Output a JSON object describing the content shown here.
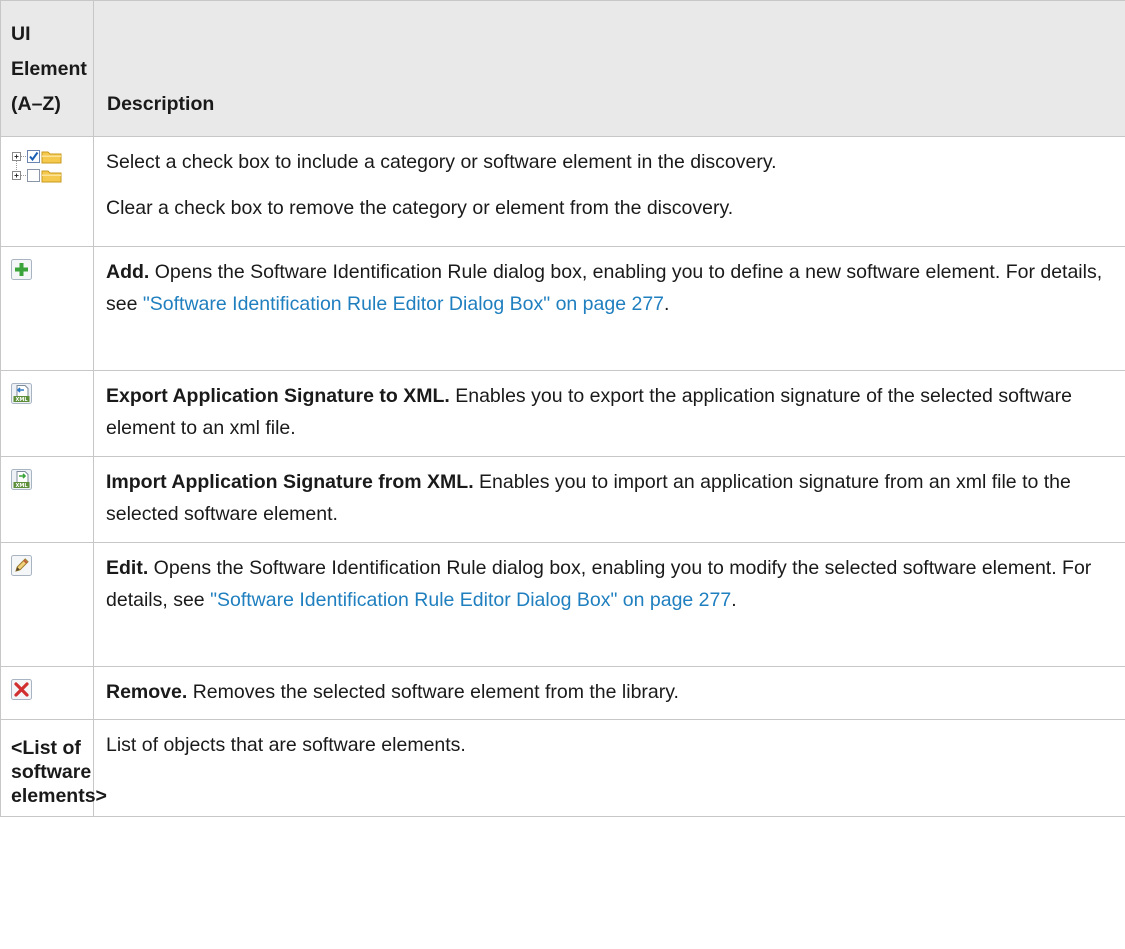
{
  "header": {
    "element_col": "UI Element (A–Z)",
    "description_col": "Description"
  },
  "rows": [
    {
      "icon": "tree-checkbox-folder-icon",
      "para1": "Select a check box to include a category or software element in the discovery.",
      "para2": "Clear a check box to remove the category or element from the discovery."
    },
    {
      "icon": "add-icon",
      "label": "Add.",
      "text": " Opens the Software Identification Rule dialog box, enabling you to define a new software element. For details, see ",
      "link": "\"Software Identification Rule Editor Dialog Box\" on page 277",
      "tail": "."
    },
    {
      "icon": "export-xml-icon",
      "label": "Export Application Signature to XML.",
      "text": " Enables you to export the application signature of the selected software element to an xml file."
    },
    {
      "icon": "import-xml-icon",
      "label": "Import Application Signature from XML.",
      "text": " Enables you to import an application signature from an xml file to the selected software element."
    },
    {
      "icon": "edit-pencil-icon",
      "label": "Edit.",
      "text": " Opens the Software Identification Rule dialog box, enabling you to modify the selected software element. For details, see ",
      "link": "\"Software Identification Rule Editor Dialog Box\" on page 277",
      "tail": "."
    },
    {
      "icon": "remove-icon",
      "label": "Remove.",
      "text": " Removes the selected software element from the library."
    },
    {
      "element_text": "<List of software elements>",
      "text": "List of objects that are software elements."
    }
  ]
}
